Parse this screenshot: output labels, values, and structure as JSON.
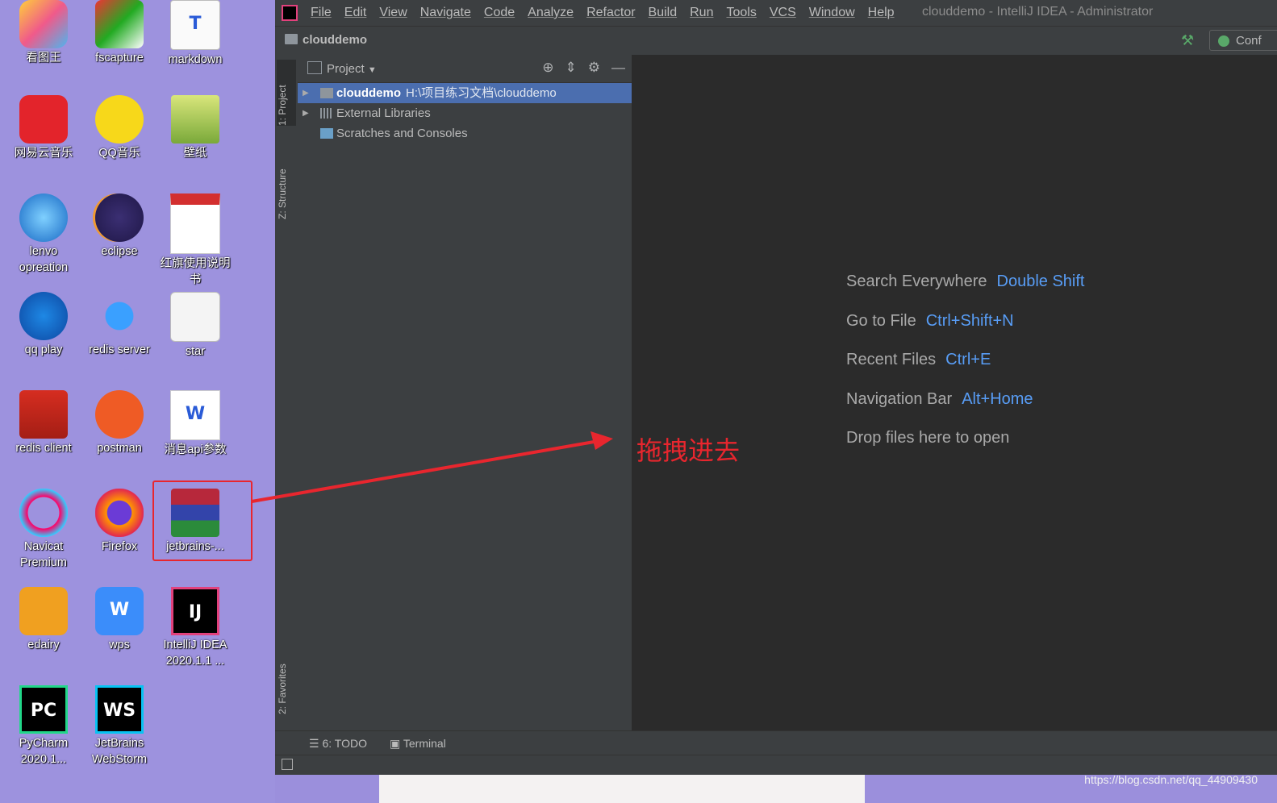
{
  "desktop": {
    "icons": [
      {
        "label": "看图王",
        "icon": "image-viewer-icon"
      },
      {
        "label": "fscapture",
        "icon": "fscapture-icon"
      },
      {
        "label": "markdown",
        "icon": "typora-icon"
      },
      {
        "label": "网易云音乐",
        "icon": "netease-music-icon"
      },
      {
        "label": "QQ音乐",
        "icon": "qq-music-icon"
      },
      {
        "label": "壁纸",
        "icon": "folder-icon"
      },
      {
        "label": "lenvo opreation",
        "icon": "internet-explorer-icon"
      },
      {
        "label": "eclipse",
        "icon": "eclipse-icon"
      },
      {
        "label": "红旗使用说明书",
        "icon": "pdf-icon"
      },
      {
        "label": "qq play",
        "icon": "qq-player-icon"
      },
      {
        "label": "redis server",
        "icon": "star-icon"
      },
      {
        "label": "star",
        "icon": "java-icon"
      },
      {
        "label": "redis client",
        "icon": "redis-icon"
      },
      {
        "label": "postman",
        "icon": "postman-icon"
      },
      {
        "label": "消息api参数",
        "icon": "word-doc-icon"
      },
      {
        "label": "Navicat Premium",
        "icon": "navicat-icon"
      },
      {
        "label": "Firefox",
        "icon": "firefox-icon"
      },
      {
        "label": "jetbrains-...",
        "icon": "winrar-archive-icon"
      },
      {
        "label": "edairy",
        "icon": "edairy-icon"
      },
      {
        "label": "wps",
        "icon": "wps-icon"
      },
      {
        "label": "IntelliJ IDEA 2020.1.1 ...",
        "icon": "intellij-icon"
      },
      {
        "label": "PyCharm 2020.1...",
        "icon": "pycharm-icon"
      },
      {
        "label": "JetBrains WebStorm",
        "icon": "webstorm-icon"
      }
    ]
  },
  "ide": {
    "menu": [
      "File",
      "Edit",
      "View",
      "Navigate",
      "Code",
      "Analyze",
      "Refactor",
      "Build",
      "Run",
      "Tools",
      "VCS",
      "Window",
      "Help"
    ],
    "window_title": "clouddemo - IntelliJ IDEA - Administrator",
    "breadcrumb": "clouddemo",
    "run_config_label": "Conf",
    "left_tabs": {
      "project": "1: Project",
      "structure": "Z: Structure",
      "favorites": "2: Favorites"
    },
    "project_panel": {
      "title": "Project",
      "tree": [
        {
          "name": "clouddemo",
          "path": "H:\\项目练习文档\\clouddemo",
          "selected": true,
          "expandable": true
        },
        {
          "name": "External Libraries",
          "path": "",
          "selected": false,
          "expandable": true
        },
        {
          "name": "Scratches and Consoles",
          "path": "",
          "selected": false,
          "expandable": false
        }
      ]
    },
    "editor_hints": [
      {
        "text": "Search Everywhere",
        "key": "Double Shift"
      },
      {
        "text": "Go to File",
        "key": "Ctrl+Shift+N"
      },
      {
        "text": "Recent Files",
        "key": "Ctrl+E"
      },
      {
        "text": "Navigation Bar",
        "key": "Alt+Home"
      },
      {
        "text": "Drop files here to open",
        "key": ""
      }
    ],
    "bottom_tabs": [
      "6: TODO",
      "Terminal"
    ]
  },
  "annotation": {
    "text": "拖拽进去",
    "color": "#e8262e"
  },
  "watermark": "https://blog.csdn.net/qq_44909430",
  "colors": {
    "desktop_bg": "#9d92de",
    "ide_bg": "#2b2b2b",
    "panel_bg": "#3c3f41",
    "selection": "#4b6eaf",
    "shortcut": "#589df6"
  }
}
